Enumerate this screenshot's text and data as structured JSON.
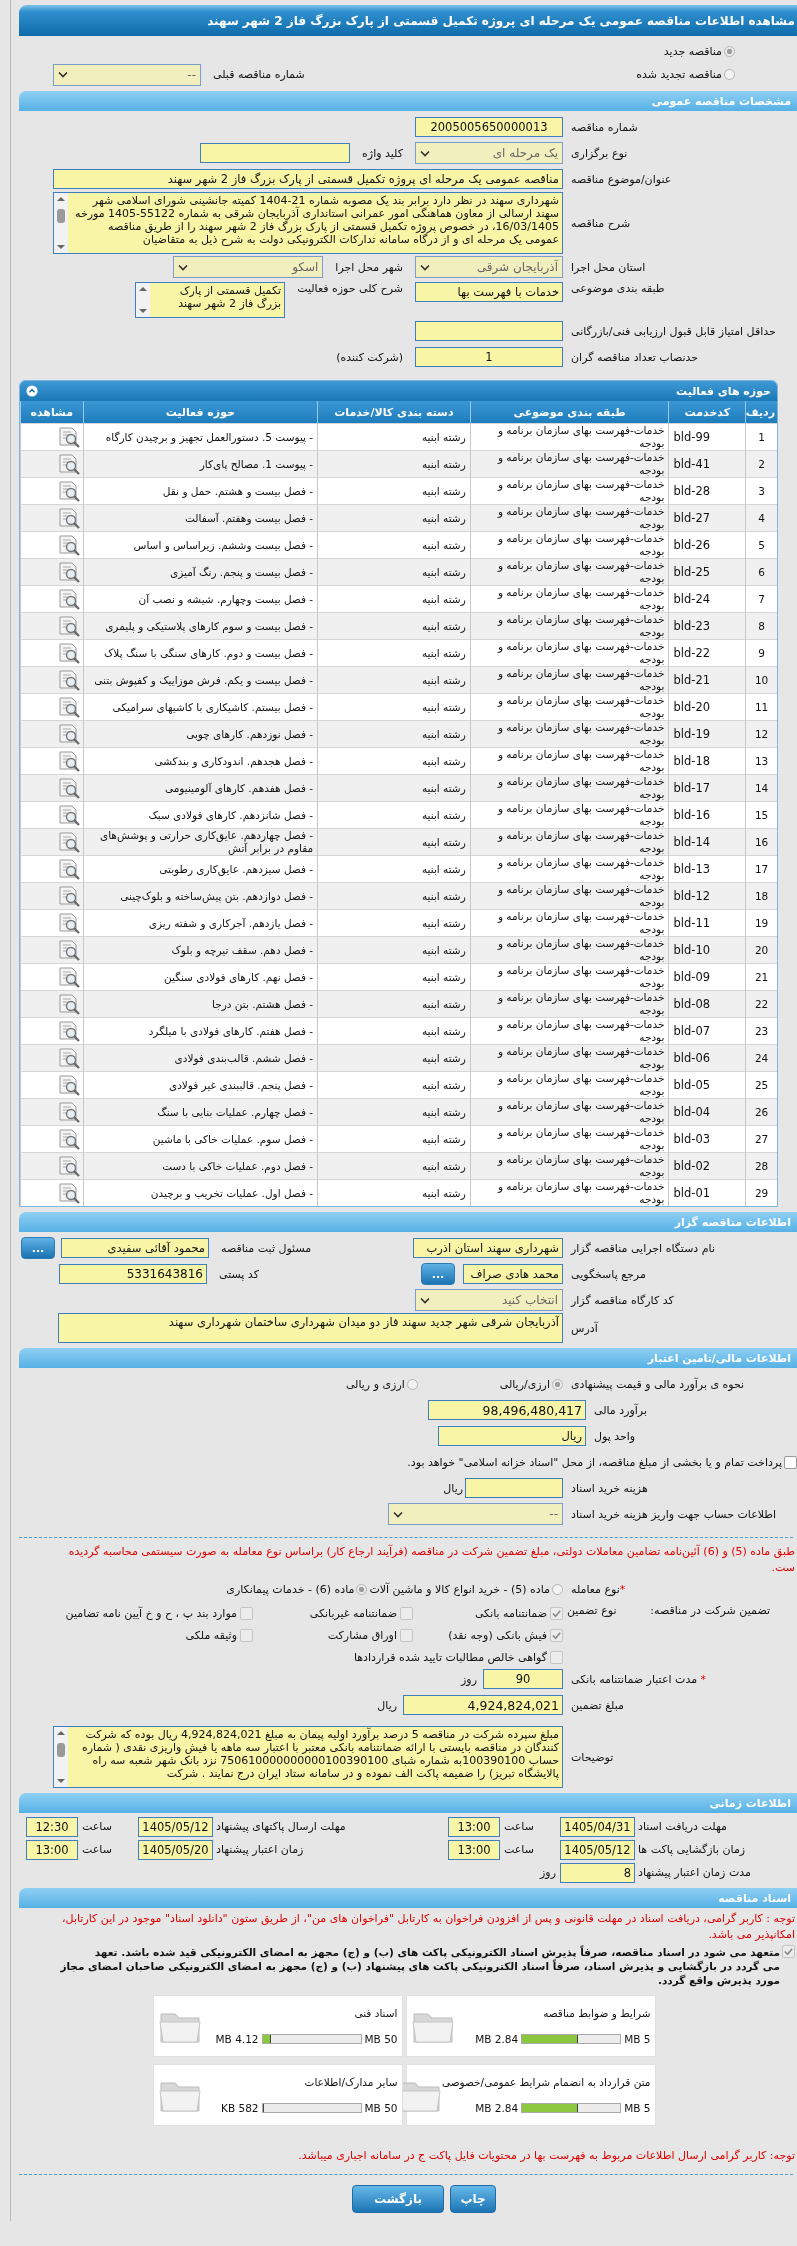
{
  "page_title": "مشاهده اطلاعات مناقصه عمومی یک مرحله ای پروژه تکمیل قسمتی از پارک بزرگ فاز 2 شهر سهند",
  "tender_type": [
    {
      "label": "مناقصه جدید",
      "selected": true
    },
    {
      "label": "مناقصه تجدید شده",
      "selected": false
    }
  ],
  "previous_tender": {
    "label": "شماره مناقصه قبلی",
    "value": "--"
  },
  "general": {
    "title": "مشخصات مناقصه عمومی",
    "number": {
      "label": "شماره مناقصه",
      "value": "2005005650000013"
    },
    "holding_type": {
      "label": "نوع برگزاری",
      "value": "یک مرحله ای"
    },
    "keyword": {
      "label": "کلید واژه"
    },
    "subject": {
      "label": "عنوان/موضوع مناقصه",
      "value": "مناقصه عمومی یک مرحله ای پروژه تکمیل قسمتی از پارک بزرگ فاز 2 شهر سهند"
    },
    "description": {
      "label": "شرح مناقصه",
      "value": "شهرداری سهند در نظر دارد برابر بند یک  مصوبه شماره 21-1404 کمیته جانشینی شورای اسلامی شهر سهند ارسالی از معاون هماهنگی امور عمرانی استانداری آذربایجان شرقی به شماره 55122-1405  مورخه 16/03/1405، در خصوص پروژه تکمیل قسمتی از پارک بزرگ فاز 2 شهر سهند را از طریق مناقصه عمومی یک مرحله ای و از درگاه سامانه تدارکات الکترونیکی دولت به شرح ذیل به متقاضیان"
    },
    "province": {
      "label": "استان محل اجرا",
      "value": "آذربایجان شرقی"
    },
    "city": {
      "label": "شهر محل اجرا",
      "value": "اسکو"
    },
    "category": {
      "label": "طبقه بندی موضوعی",
      "value": "خدمات با فهرست بها"
    },
    "activity_summary": {
      "label": "شرح کلی حوزه فعالیت",
      "value": "تکمیل قسمتی از پارک بزرگ فاز 2 شهر سهند"
    },
    "min_score": {
      "label": "حداقل امتیاز قابل قبول ارزیابی فنی/بازرگانی"
    },
    "min_bidders": {
      "label": "حدنصاب تعداد مناقصه گران",
      "value": "1",
      "suffix": "(شرکت کننده)"
    }
  },
  "activities": {
    "title": "حوزه های فعالیت",
    "columns": [
      "ردیف",
      "کدخدمت",
      "طبقه بندی موضوعی",
      "دسته بندی کالا/خدمات",
      "حوزه فعالیت",
      "مشاهده"
    ],
    "rows": [
      {
        "row": "1",
        "code": "bld-99",
        "classification": "خدمات-فهرست بهای سازمان برنامه و بودجه",
        "category": "رشته ابنیه",
        "activity": "- پیوست 5. دستورالعمل تجهیز و برچیدن کارگاه"
      },
      {
        "row": "2",
        "code": "bld-41",
        "classification": "خدمات-فهرست بهای سازمان برنامه و بودجه",
        "category": "رشته ابنیه",
        "activity": "- پیوست 1. مصالح پای‌کار"
      },
      {
        "row": "3",
        "code": "bld-28",
        "classification": "خدمات-فهرست بهای سازمان برنامه و بودجه",
        "category": "رشته ابنیه",
        "activity": "- فصل بیست و هشتم. حمل و نقل"
      },
      {
        "row": "4",
        "code": "bld-27",
        "classification": "خدمات-فهرست بهای سازمان برنامه و بودجه",
        "category": "رشته ابنیه",
        "activity": "- فصل بیست وهفتم. آسفالت"
      },
      {
        "row": "5",
        "code": "bld-26",
        "classification": "خدمات-فهرست بهای سازمان برنامه و بودجه",
        "category": "رشته ابنیه",
        "activity": "- فصل بیست وششم. زیراساس و اساس"
      },
      {
        "row": "6",
        "code": "bld-25",
        "classification": "خدمات-فهرست بهای سازمان برنامه و بودجه",
        "category": "رشته ابنیه",
        "activity": "- فصل بیست و پنجم. رنگ آمیزی"
      },
      {
        "row": "7",
        "code": "bld-24",
        "classification": "خدمات-فهرست بهای سازمان برنامه و بودجه",
        "category": "رشته ابنیه",
        "activity": "- فصل بیست وچهارم. شیشه و نصب آن"
      },
      {
        "row": "8",
        "code": "bld-23",
        "classification": "خدمات-فهرست بهای سازمان برنامه و بودجه",
        "category": "رشته ابنیه",
        "activity": "- فصل بیست و سوم کارهای پلاستیکی و پلیمری"
      },
      {
        "row": "9",
        "code": "bld-22",
        "classification": "خدمات-فهرست بهای سازمان برنامه و بودجه",
        "category": "رشته ابنیه",
        "activity": "- فصل بیست و دوم. کارهای سنگی با سنگ پلاک"
      },
      {
        "row": "10",
        "code": "bld-21",
        "classification": "خدمات-فهرست بهای سازمان برنامه و بودجه",
        "category": "رشته ابنیه",
        "activity": "- فصل بیست و یکم. فرش موزاییک و کفپوش بتنی"
      },
      {
        "row": "11",
        "code": "bld-20",
        "classification": "خدمات-فهرست بهای سازمان برنامه و بودجه",
        "category": "رشته ابنیه",
        "activity": "- فصل بیستم. کاشیکاری با کاشیهای سرامیکی"
      },
      {
        "row": "12",
        "code": "bld-19",
        "classification": "خدمات-فهرست بهای سازمان برنامه و بودجه",
        "category": "رشته ابنیه",
        "activity": "- فصل نوزدهم. کارهای چوبی"
      },
      {
        "row": "13",
        "code": "bld-18",
        "classification": "خدمات-فهرست بهای سازمان برنامه و بودجه",
        "category": "رشته ابنیه",
        "activity": "- فصل هجدهم. اندودکاری و بندکشی"
      },
      {
        "row": "14",
        "code": "bld-17",
        "classification": "خدمات-فهرست بهای سازمان برنامه و بودجه",
        "category": "رشته ابنیه",
        "activity": "- فصل هفدهم. کارهای آلومینیومی"
      },
      {
        "row": "15",
        "code": "bld-16",
        "classification": "خدمات-فهرست بهای سازمان برنامه و بودجه",
        "category": "رشته ابنیه",
        "activity": "- فصل شانزدهم. کارهای فولادی سبک"
      },
      {
        "row": "16",
        "code": "bld-14",
        "classification": "خدمات-فهرست بهای سازمان برنامه و بودجه",
        "category": "رشته ابنیه",
        "activity": "- فصل چهاردهم. عایق‌کاری حرارتی و پوشش‌های مقاوم در برابر آتش"
      },
      {
        "row": "17",
        "code": "bld-13",
        "classification": "خدمات-فهرست بهای سازمان برنامه و بودجه",
        "category": "رشته ابنیه",
        "activity": "- فصل سیزدهم. عایق‌کاری رطوبتی"
      },
      {
        "row": "18",
        "code": "bld-12",
        "classification": "خدمات-فهرست بهای سازمان برنامه و بودجه",
        "category": "رشته ابنیه",
        "activity": "- فصل دوازدهم. بتن پیش‌ساخته و بلوک‌چینی"
      },
      {
        "row": "19",
        "code": "bld-11",
        "classification": "خدمات-فهرست بهای سازمان برنامه و بودجه",
        "category": "رشته ابنیه",
        "activity": "- فصل یازدهم. آجرکاری و شفته ریزی"
      },
      {
        "row": "20",
        "code": "bld-10",
        "classification": "خدمات-فهرست بهای سازمان برنامه و بودجه",
        "category": "رشته ابنیه",
        "activity": "- فصل دهم. سقف تیرچه و بلوک"
      },
      {
        "row": "21",
        "code": "bld-09",
        "classification": "خدمات-فهرست بهای سازمان برنامه و بودجه",
        "category": "رشته ابنیه",
        "activity": "- فصل نهم. کارهای فولادی سنگین"
      },
      {
        "row": "22",
        "code": "bld-08",
        "classification": "خدمات-فهرست بهای سازمان برنامه و بودجه",
        "category": "رشته ابنیه",
        "activity": "- فصل هشتم. بتن درجا"
      },
      {
        "row": "23",
        "code": "bld-07",
        "classification": "خدمات-فهرست بهای سازمان برنامه و بودجه",
        "category": "رشته ابنیه",
        "activity": "- فصل هفتم. کارهای فولادی با میلگرد"
      },
      {
        "row": "24",
        "code": "bld-06",
        "classification": "خدمات-فهرست بهای سازمان برنامه و بودجه",
        "category": "رشته ابنیه",
        "activity": "- فصل ششم. قالب‌بندی فولادی"
      },
      {
        "row": "25",
        "code": "bld-05",
        "classification": "خدمات-فهرست بهای سازمان برنامه و بودجه",
        "category": "رشته ابنیه",
        "activity": "- فصل پنجم. قالببندی غیر فولادی"
      },
      {
        "row": "26",
        "code": "bld-04",
        "classification": "خدمات-فهرست بهای سازمان برنامه و بودجه",
        "category": "رشته ابنیه",
        "activity": "- فصل چهارم. عملیات بنایی با سنگ"
      },
      {
        "row": "27",
        "code": "bld-03",
        "classification": "خدمات-فهرست بهای سازمان برنامه و بودجه",
        "category": "رشته ابنیه",
        "activity": "- فصل سوم. عملیات خاکی با ماشین"
      },
      {
        "row": "28",
        "code": "bld-02",
        "classification": "خدمات-فهرست بهای سازمان برنامه و بودجه",
        "category": "رشته ابنیه",
        "activity": "- فصل دوم. عملیات خاکی با دست"
      },
      {
        "row": "29",
        "code": "bld-01",
        "classification": "خدمات-فهرست بهای سازمان برنامه و بودجه",
        "category": "رشته ابنیه",
        "activity": "- فصل اول. عملیات تخریب و برچیدن"
      }
    ]
  },
  "tenderer": {
    "title": "اطلاعات مناقصه گزار",
    "organization": {
      "label": "نام دستگاه اجرایی مناقصه گزار",
      "value": "شهرداری سهند استان اذرب"
    },
    "registrar": {
      "label": "مسئول ثبت مناقصه",
      "value": "محمود آقائی سفیدی",
      "button": "..."
    },
    "contact": {
      "label": "مرجع پاسخگویی",
      "value": "محمد هادی صراف",
      "button": "..."
    },
    "postal_code": {
      "label": "کد پستی",
      "value": "5331643816"
    },
    "workshop_code": {
      "label": "کد کارگاه مناقصه گزار",
      "value": "انتخاب کنید"
    },
    "address": {
      "label": "آدرس",
      "value": "آذربایجان شرقی شهر جدید سهند فاز دو میدان شهرداری ساختمان شهرداری سهند"
    }
  },
  "finance": {
    "title": "اطلاعات مالی/تامین اعتبار",
    "method": {
      "label": "نحوه ی برآورد مالی و قیمت پیشنهادی",
      "options": [
        {
          "label": "ارزی/ریالی",
          "selected": true
        },
        {
          "label": "ارزی و ریالی",
          "selected": false
        }
      ]
    },
    "estimate": {
      "label": "برآورد مالی",
      "value": "98,496,480,417"
    },
    "currency": {
      "label": "واحد پول",
      "value": "ریال"
    },
    "treasury": {
      "label": "پرداخت تمام و یا بخشی از مبلغ مناقصه، از محل \"اسناد خزانه اسلامی\" خواهد بود.",
      "checked": false
    },
    "document_fee": {
      "label": "هزینه خرید اسناد",
      "unit": "ریال"
    },
    "account": {
      "label": "اطلاعات حساب جهت واریز هزینه خرید اسناد",
      "value": "--"
    }
  },
  "guarantee": {
    "notice": [
      "طبق ماده (5) و (6) آئین‌نامه تضامین معاملات دولتی، مبلغ تضمین شرکت در مناقصه (فرآیند ارجاع کار) براساس نوع معامله به صورت سیستمی محاسبه گردیده",
      "ست."
    ],
    "deal_type": {
      "required_mark": "*",
      "label": "نوع معامله",
      "options": [
        {
          "label": "ماده (5) - خرید انواع کالا و ماشین آلات",
          "selected": false
        },
        {
          "label": "ماده (6) - خدمات پیمانکاری",
          "selected": true
        }
      ]
    },
    "label": "تضمین شرکت در مناقصه:",
    "type_label": "نوع تضمین",
    "types": [
      {
        "label": "ضمانتنامه بانکی",
        "checked": true
      },
      {
        "label": "ضمانتنامه غیربانکی",
        "checked": false
      },
      {
        "label": "موارد بند پ ، ح و خ آیین نامه تضامین",
        "checked": false
      },
      {
        "label": "فیش بانکی (وجه نقد)",
        "checked": true
      },
      {
        "label": "اوراق مشارکت",
        "checked": false
      },
      {
        "label": "وثیقه ملکی",
        "checked": false
      },
      {
        "label": "گواهی خالص مطالبات تایید شده قراردادها",
        "checked": false
      }
    ],
    "validity": {
      "required_mark": "*",
      "label": "مدت اعتبار ضمانتنامه بانکی",
      "value": "90",
      "unit": "روز"
    },
    "amount": {
      "label": "مبلغ تضمین",
      "value": "4,924,824,021",
      "unit": "ریال"
    },
    "notes": {
      "label": "توضیحات",
      "value": "مبلغ سپرده شرکت در مناقصه 5 درصد  برآورد اولیه پیمان به مبلغ  4,924,824,021 ریال بوده که شرکت کنندگان در مناقصه بایستی با ارائه ضمانتنامه بانکی معتبر با اعتبار سه ماهه یا فیش واریزی نقدی ( شماره حساب 100390100به شماره شبای 750610000000000100390100 نزد بانک شهر شعبه سه راه پالایشگاه تبریز) را ضمیمه پاکت الف نموده و در سامانه ستاد ایران درج نمایند . شرکت"
    }
  },
  "schedule": {
    "title": "اطلاعات زمانی",
    "items": [
      {
        "label": "مهلت دریافت اسناد",
        "date": "1405/04/31",
        "time_label": "ساعت",
        "time": "13:00"
      },
      {
        "label": "مهلت ارسال پاکتهای پیشنهاد",
        "date": "1405/05/12",
        "time_label": "ساعت",
        "time": "12:30"
      },
      {
        "label": "زمان بازگشایی پاکت ها",
        "date": "1405/05/12",
        "time_label": "ساعت",
        "time": "13:00"
      },
      {
        "label": "زمان اعتبار پیشنهاد",
        "date": "1405/05/20",
        "time_label": "ساعت",
        "time": "13:00"
      }
    ],
    "duration": {
      "label": "مدت زمان اعتبار پیشنهاد",
      "value": "8",
      "unit": "روز"
    }
  },
  "documents": {
    "title": "اسناد مناقصه",
    "notice": [
      "توجه : کاربر گرامی، دریافت اسناد در مهلت قانونی و پس از افزودن فراخوان به کارتابل \"فراخوان های من\"، از طریق ستون \"دانلود اسناد\" موجود در این کارتابل،",
      "امکانپذیر می باشد."
    ],
    "commitment": {
      "checked": true,
      "lines": [
        "متعهد می شود در اسناد مناقصه، صرفاً پذیرش اسناد الکترونیکی پاکت های (ب) و (ج) مجهز به امضای الکترونیکی قید شده باشد. تعهد",
        "می گردد در بازگشایی و پذیرش اسناد، صرفاً اسناد الکترونیکی پاکت های پیشنهاد (ب) و (ج) مجهز به امضای الکترونیکی صاحبان امضای مجاز",
        "مورد پذیرش واقع گردد."
      ]
    },
    "files": [
      {
        "name": "شرایط و ضوابط مناقصه",
        "max": "5 MB",
        "size": "2.84 MB",
        "level": 0.568
      },
      {
        "name": "اسناد فنی",
        "max": "50 MB",
        "size": "4.12 MB",
        "level": 0.082
      },
      {
        "name": "متن قرارداد به انضمام شرایط عمومی/خصوصی",
        "max": "5 MB",
        "size": "2.84 MB",
        "level": 0.568
      },
      {
        "name": "سایر مدارک/اطلاعات",
        "max": "50 MB",
        "size": "582 KB",
        "level": 0.011
      }
    ],
    "bottom_notice": "توجه: کاربر گرامی ارسال اطلاعات مربوط به فهرست بها در محتویات فایل پاکت ج در سامانه اجباری میباشد."
  },
  "buttons": [
    "چاپ",
    "بازگشت"
  ]
}
